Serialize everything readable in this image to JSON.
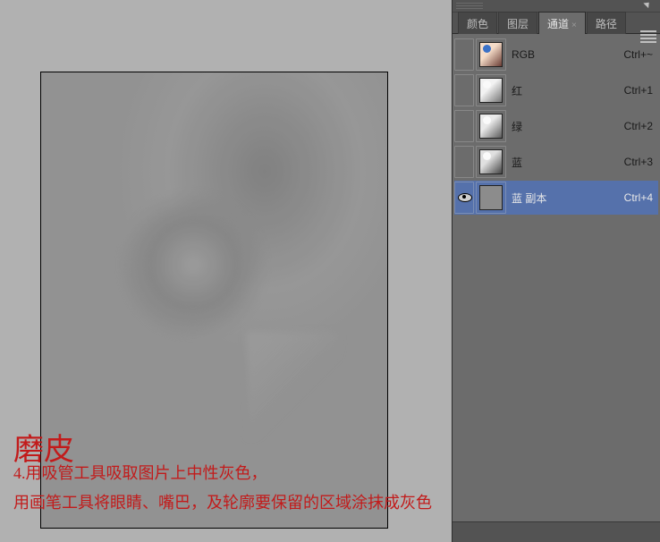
{
  "annotation": {
    "title": "磨皮",
    "step": "4.用吸管工具吸取图片上中性灰色，",
    "detail": "用画笔工具将眼睛、嘴巴，及轮廓要保留的区域涂抹成灰色"
  },
  "panel": {
    "tabs": [
      {
        "label": "颜色",
        "active": false
      },
      {
        "label": "图层",
        "active": false
      },
      {
        "label": "通道",
        "active": true
      },
      {
        "label": "路径",
        "active": false
      }
    ]
  },
  "channels": [
    {
      "name": "RGB",
      "shortcut": "Ctrl+~",
      "thumb": "rgb",
      "visible": false,
      "selected": false
    },
    {
      "name": "红",
      "shortcut": "Ctrl+1",
      "thumb": "red",
      "visible": false,
      "selected": false
    },
    {
      "name": "绿",
      "shortcut": "Ctrl+2",
      "thumb": "green",
      "visible": false,
      "selected": false
    },
    {
      "name": "蓝",
      "shortcut": "Ctrl+3",
      "thumb": "blue",
      "visible": false,
      "selected": false
    },
    {
      "name": "蓝 副本",
      "shortcut": "Ctrl+4",
      "thumb": "gray",
      "visible": true,
      "selected": true
    }
  ]
}
